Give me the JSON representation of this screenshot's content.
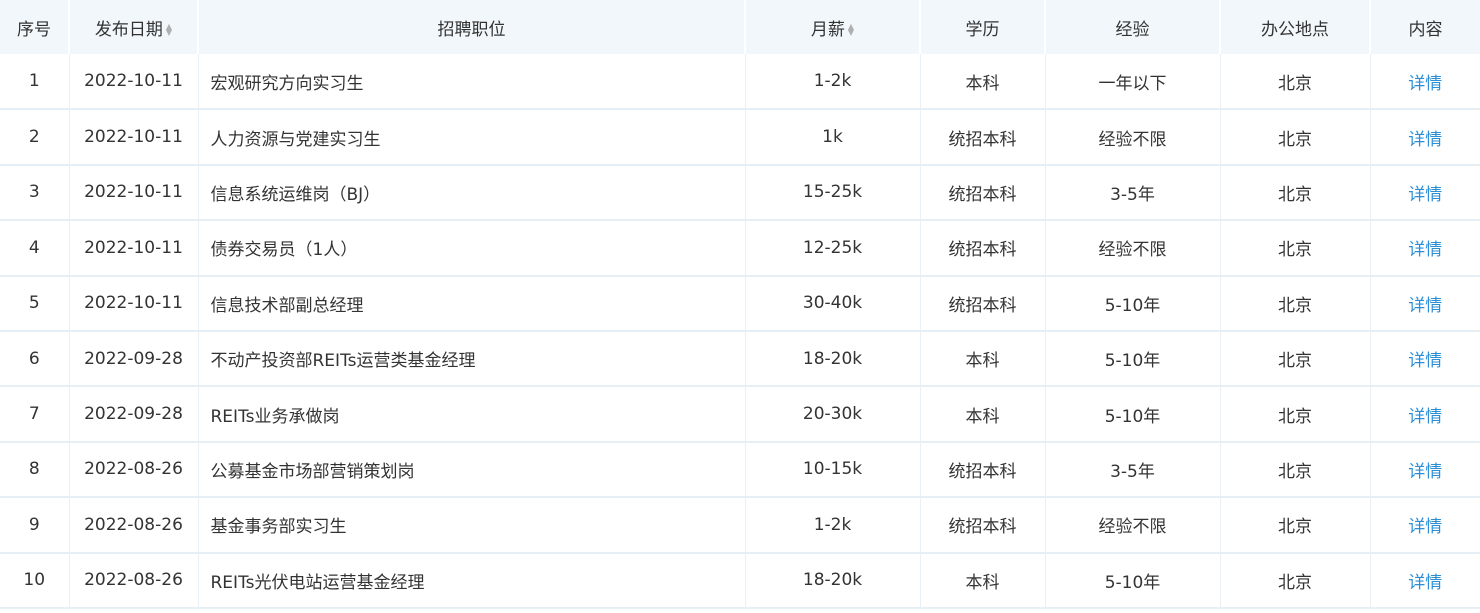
{
  "headers": {
    "index": "序号",
    "date": "发布日期",
    "title": "招聘职位",
    "salary": "月薪",
    "education": "学历",
    "experience": "经验",
    "location": "办公地点",
    "detail": "内容"
  },
  "icons": {
    "sort": "sort-up-down-icon",
    "sort_color": "#b0b0b0"
  },
  "colors": {
    "header_bg": "#f1f7fb",
    "link": "#2b8fd8",
    "row_border": "#e6eff5"
  },
  "rows": [
    {
      "index": "1",
      "date": "2022-10-11",
      "title": "宏观研究方向实习生",
      "salary": "1-2k",
      "education": "本科",
      "experience": "一年以下",
      "location": "北京",
      "detail": "详情"
    },
    {
      "index": "2",
      "date": "2022-10-11",
      "title": "人力资源与党建实习生",
      "salary": "1k",
      "education": "统招本科",
      "experience": "经验不限",
      "location": "北京",
      "detail": "详情"
    },
    {
      "index": "3",
      "date": "2022-10-11",
      "title": "信息系统运维岗（BJ）",
      "salary": "15-25k",
      "education": "统招本科",
      "experience": "3-5年",
      "location": "北京",
      "detail": "详情"
    },
    {
      "index": "4",
      "date": "2022-10-11",
      "title": "债券交易员（1人）",
      "salary": "12-25k",
      "education": "统招本科",
      "experience": "经验不限",
      "location": "北京",
      "detail": "详情"
    },
    {
      "index": "5",
      "date": "2022-10-11",
      "title": "信息技术部副总经理",
      "salary": "30-40k",
      "education": "统招本科",
      "experience": "5-10年",
      "location": "北京",
      "detail": "详情"
    },
    {
      "index": "6",
      "date": "2022-09-28",
      "title": "不动产投资部REITs运营类基金经理",
      "salary": "18-20k",
      "education": "本科",
      "experience": "5-10年",
      "location": "北京",
      "detail": "详情"
    },
    {
      "index": "7",
      "date": "2022-09-28",
      "title": "REITs业务承做岗",
      "salary": "20-30k",
      "education": "本科",
      "experience": "5-10年",
      "location": "北京",
      "detail": "详情"
    },
    {
      "index": "8",
      "date": "2022-08-26",
      "title": "公募基金市场部营销策划岗",
      "salary": "10-15k",
      "education": "统招本科",
      "experience": "3-5年",
      "location": "北京",
      "detail": "详情"
    },
    {
      "index": "9",
      "date": "2022-08-26",
      "title": "基金事务部实习生",
      "salary": "1-2k",
      "education": "统招本科",
      "experience": "经验不限",
      "location": "北京",
      "detail": "详情"
    },
    {
      "index": "10",
      "date": "2022-08-26",
      "title": "REITs光伏电站运营基金经理",
      "salary": "18-20k",
      "education": "本科",
      "experience": "5-10年",
      "location": "北京",
      "detail": "详情"
    }
  ]
}
